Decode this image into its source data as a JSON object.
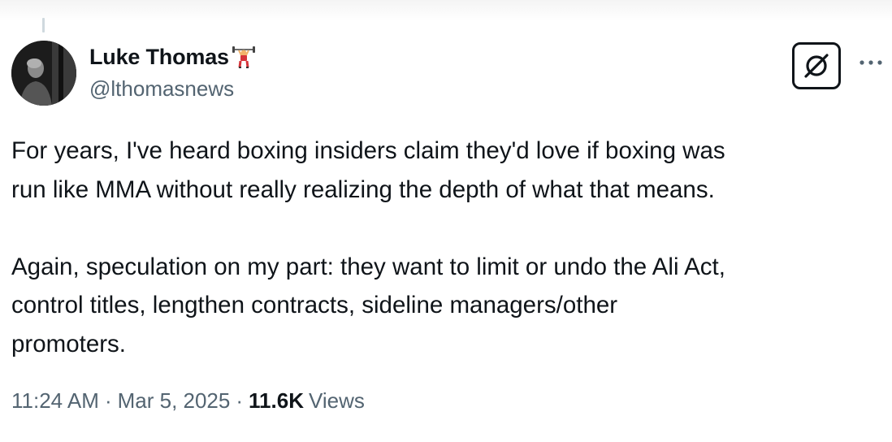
{
  "author": {
    "display_name": "Luke Thomas",
    "badge_emoji": "weightlifter-emoji",
    "handle": "@lthomasnews"
  },
  "actions": {
    "grok_icon": "grok-slash-icon",
    "more_icon": "more-dots-icon"
  },
  "tweet": {
    "lines": [
      "For years, I've heard boxing insiders claim they'd love if boxing was",
      "run like MMA without really realizing the depth of what that means.",
      "Again, speculation on my part: they want to limit or undo the Ali Act,",
      "control titles, lengthen contracts, sideline managers/other",
      "promoters."
    ]
  },
  "meta": {
    "time": "11:24 AM",
    "separator": "·",
    "date": "Mar 5, 2025",
    "views_count": "11.6K",
    "views_label": "Views"
  },
  "colors": {
    "text_primary": "#0f1419",
    "text_secondary": "#536471"
  }
}
